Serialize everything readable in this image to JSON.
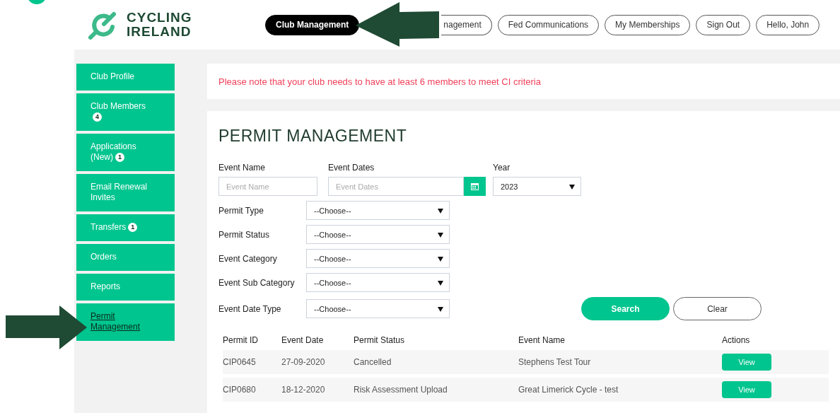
{
  "header": {
    "logo_lines": [
      "CYCLING",
      "IRELAND"
    ],
    "nav": [
      {
        "label": "Club Management",
        "selected": true,
        "kind": "whole"
      },
      {
        "label": "nagement",
        "selected": false,
        "kind": "cut"
      },
      {
        "label": "Fed Communications",
        "selected": false,
        "kind": "whole"
      },
      {
        "label": "My Memberships",
        "selected": false,
        "kind": "whole"
      },
      {
        "label": "Sign Out",
        "selected": false,
        "kind": "whole"
      },
      {
        "label": "Hello, John",
        "selected": false,
        "kind": "whole"
      }
    ]
  },
  "sidebar": {
    "items": [
      {
        "label": "Club Profile",
        "selected": false
      },
      {
        "label": "Club Members",
        "badge": "4",
        "selected": false
      },
      {
        "label": "Applications (New)",
        "badge": "1",
        "selected": false
      },
      {
        "label": "Email Renewal Invites",
        "selected": false
      },
      {
        "label": "Transfers",
        "badge": "1",
        "selected": false
      },
      {
        "label": "Orders",
        "selected": false
      },
      {
        "label": "Reports",
        "selected": false
      },
      {
        "label": "Permit Management",
        "selected": true
      }
    ]
  },
  "notice": "Please note that your club needs to have at least 6 members to meet CI criteria",
  "title": "PERMIT MANAGEMENT",
  "filters": {
    "event_name": {
      "label": "Event Name",
      "placeholder": "Event Name"
    },
    "event_dates": {
      "label": "Event Dates",
      "placeholder": "Event Dates"
    },
    "year": {
      "label": "Year",
      "value": "2023"
    },
    "selects": [
      {
        "label": "Permit Type",
        "value": "--Choose--"
      },
      {
        "label": "Permit Status",
        "value": "--Choose--"
      },
      {
        "label": "Event Category",
        "value": "--Choose--"
      },
      {
        "label": "Event Sub Category",
        "value": "--Choose--"
      },
      {
        "label": "Event Date Type",
        "value": "--Choose--"
      }
    ],
    "buttons": [
      {
        "label": "Search",
        "kind": "primary"
      },
      {
        "label": "Clear",
        "kind": "outline"
      }
    ]
  },
  "table": {
    "columns": [
      "Permit ID",
      "Event Date",
      "Permit Status",
      "Event Name",
      "Actions"
    ],
    "rows": [
      {
        "cells": [
          "CIP0645",
          "27-09-2020",
          "Cancelled",
          "Stephens Test Tour"
        ],
        "action": "View"
      },
      {
        "cells": [
          "CIP0680",
          "18-12-2020",
          "Risk Assessment Upload",
          "Great Limerick Cycle - test"
        ],
        "action": "View"
      }
    ]
  }
}
